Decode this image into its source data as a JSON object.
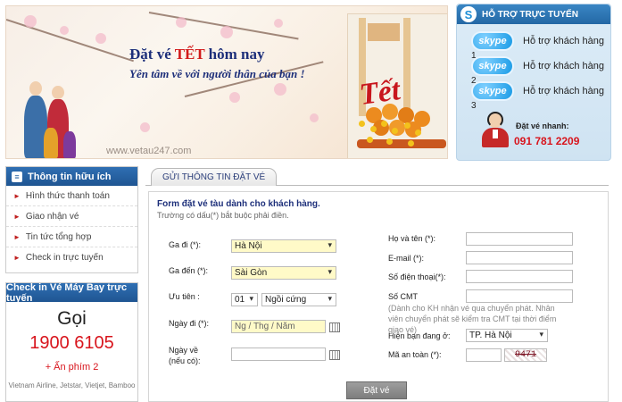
{
  "banner": {
    "title_part1": "Đặt vé ",
    "title_tet": "TẾT",
    "title_part2": " hôm nay",
    "subtitle": "Yên tâm về với người thân của bạn !",
    "url": "www.vetau247.com",
    "card_word": "Tết"
  },
  "support": {
    "header": "HỖ TRỢ TRỰC TUYẾN",
    "skype_label": "skype",
    "items": [
      {
        "text": "Hỗ trợ khách hàng",
        "number": "1"
      },
      {
        "text": "Hỗ trợ khách hàng",
        "number": "2"
      },
      {
        "text": "Hỗ trợ khách hàng",
        "number": "3"
      }
    ],
    "hotline_label": "Đặt vé nhanh:",
    "hotline_number": "091 781 2209"
  },
  "sidebar": {
    "title": "Thông tin hữu ích",
    "items": [
      "Hình thức thanh toán",
      "Giao nhận vé",
      "Tin tức tổng hợp",
      "Check in trực tuyến"
    ]
  },
  "checkin": {
    "title": "Check in Vé Máy Bay trực tuyến",
    "call_word": "Gọi",
    "call_number": "1900 6105",
    "extension": "+ Ấn phím 2",
    "airlines": "Vietnam Airline, Jetstar, Vietjet, Bamboo"
  },
  "form": {
    "tab_label": "GỬI THÔNG TIN ĐẶT VÉ",
    "title": "Form đặt vé tàu dành cho khách hàng.",
    "note": "Trường có dấu(*) bắt buộc phải điền.",
    "depart_label": "Ga đi (*):",
    "depart_value": "Hà Nội",
    "arrive_label": "Ga đến (*):",
    "arrive_value": "Sài Gòn",
    "priority_label": "Ưu tiên :",
    "priority_count": "01",
    "priority_type": "Ngồi cứng",
    "date_go_label": "Ngày đi (*):",
    "date_go_placeholder": "Ng / Thg / Năm",
    "date_back_label": "Ngày về",
    "date_back_note": "(nếu có):",
    "name_label": "Họ và tên (*):",
    "email_label": "E-mail (*):",
    "phone_label": "Số điện thoại(*):",
    "cmt_label": "Số CMT",
    "cmt_note": "(Dành cho KH nhận vé qua chuyển phát. Nhân viên chuyển phát sẽ kiểm tra CMT tại thời điểm giao vé)",
    "location_label": "Hiện bạn đang ở:",
    "location_value": "TP. Hà Nội",
    "captcha_label": "Mã an toàn (*):",
    "captcha_value": "9471",
    "submit": "Đặt vé"
  },
  "colors": {
    "header_blue": "#2468a5",
    "accent_red": "#d8141c",
    "navy_text": "#1d2f7a",
    "required_yellow": "#fffac8"
  }
}
